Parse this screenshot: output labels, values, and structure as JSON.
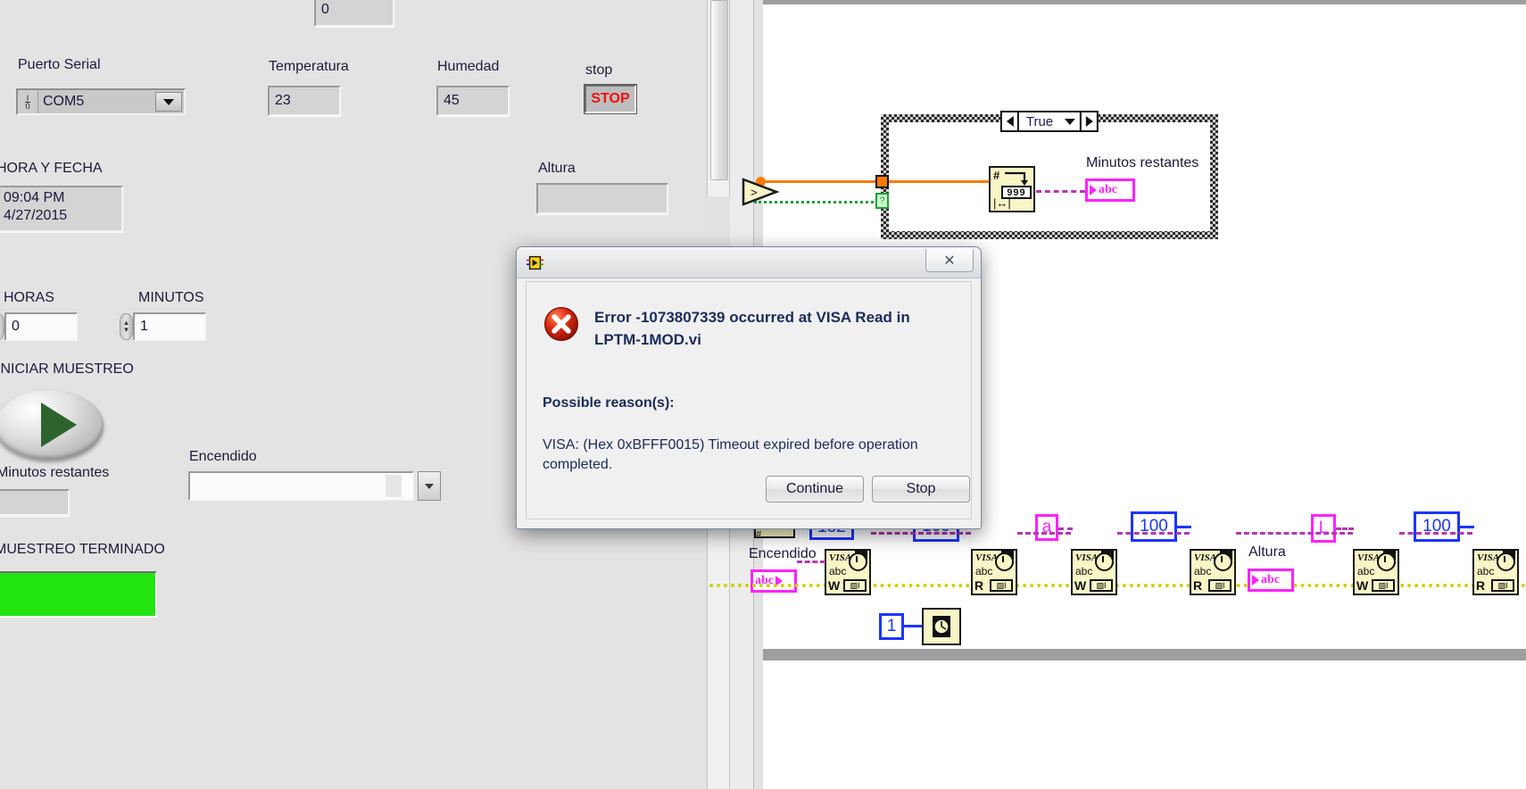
{
  "front_panel": {
    "top_numeric": {
      "label": "",
      "value": "0"
    },
    "puerto_serial": {
      "label": "Puerto Serial",
      "value": "COM5",
      "io_glyph": "I/0"
    },
    "temperatura": {
      "label": "Temperatura",
      "value": "23"
    },
    "humedad": {
      "label": "Humedad",
      "value": "45"
    },
    "stop": {
      "label": "stop",
      "button_text": "STOP",
      "color": "#f30c0c"
    },
    "hora_y_fecha": {
      "label": "HORA Y FECHA",
      "time": "09:04 PM",
      "date": "4/27/2015"
    },
    "altura": {
      "label": "Altura",
      "value": ""
    },
    "horas": {
      "label": "HORAS",
      "value": "0"
    },
    "minutos": {
      "label": "MINUTOS",
      "value": "1"
    },
    "iniciar_muestreo": {
      "label": "INICIAR MUESTREO"
    },
    "minutos_restantes": {
      "label": "Minutos restantes",
      "value": ""
    },
    "encendido": {
      "label": "Encendido",
      "value": ""
    },
    "muestreo_terminado": {
      "label": "MUESTREO TERMINADO",
      "state": "on",
      "color": "#22e512"
    }
  },
  "block_diagram": {
    "case_structure": {
      "selector_value": "True"
    },
    "minutos_restantes_label": "Minutos restantes",
    "number_to_string_node": {
      "format": "999"
    },
    "encendido_label": "Encendido",
    "altura_label": "Altura",
    "constants": {
      "c132": "132",
      "c100_a": "100",
      "c100_b": "100",
      "c100_c": "100",
      "char_a": "a",
      "char_L": "L",
      "wait_ms": "1"
    },
    "visa_nodes": [
      {
        "name": "visa-write-1",
        "mode": "W",
        "label": "VISA",
        "sub": "abc"
      },
      {
        "name": "visa-write-2",
        "mode": "W",
        "label": "VISA",
        "sub": "abc"
      },
      {
        "name": "visa-read-1",
        "mode": "R",
        "label": "VISA",
        "sub": "abc"
      },
      {
        "name": "visa-write-3",
        "mode": "W",
        "label": "VISA",
        "sub": "abc"
      },
      {
        "name": "visa-read-2",
        "mode": "R",
        "label": "VISA",
        "sub": "abc"
      },
      {
        "name": "visa-write-4",
        "mode": "W",
        "label": "VISA",
        "sub": "abc"
      },
      {
        "name": "visa-read-3",
        "mode": "R",
        "label": "VISA",
        "sub": "abc"
      }
    ]
  },
  "error_dialog": {
    "title_bar_text": "",
    "close_label": "✕",
    "error_heading": "Error -1073807339 occurred at VISA Read in LPTM-1MOD.vi",
    "reason_heading": "Possible reason(s):",
    "reason_body": "VISA:  (Hex 0xBFFF0015) Timeout expired before operation completed.",
    "buttons": {
      "continue": "Continue",
      "stop": "Stop"
    }
  }
}
